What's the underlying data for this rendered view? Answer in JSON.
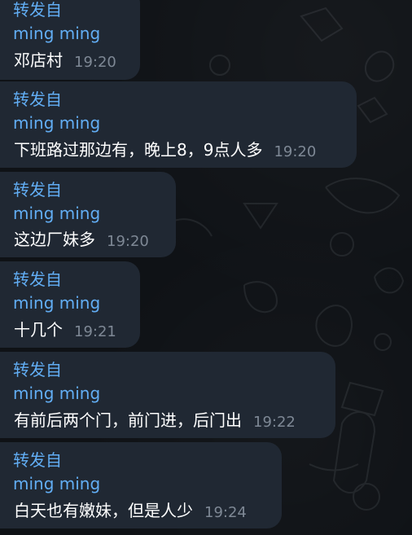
{
  "chat": {
    "messages": [
      {
        "forwarded_label": "转发自",
        "sender": "ming ming",
        "text": "邓店村",
        "time": "19:20"
      },
      {
        "forwarded_label": "转发自",
        "sender": "ming ming",
        "text": "下班路过那边有，晚上8，9点人多",
        "time": "19:20"
      },
      {
        "forwarded_label": "转发自",
        "sender": "ming ming",
        "text": "这边厂妹多",
        "time": "19:20"
      },
      {
        "forwarded_label": "转发自",
        "sender": "ming ming",
        "text": "十几个",
        "time": "19:21"
      },
      {
        "forwarded_label": "转发自",
        "sender": "ming ming",
        "text": "有前后两个门，前门进，后门出",
        "time": "19:22"
      },
      {
        "forwarded_label": "转发自",
        "sender": "ming ming",
        "text": "白天也有嫩妹，但是人少",
        "time": "19:24"
      }
    ]
  },
  "colors": {
    "background": "#0f1216",
    "bubble": "#202833",
    "accent": "#62aef5",
    "text": "#ffffff",
    "timestamp": "#7e8895"
  }
}
